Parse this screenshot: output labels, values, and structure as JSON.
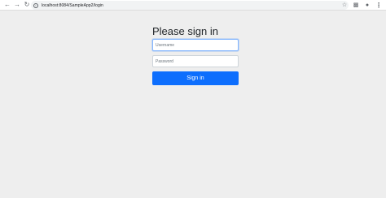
{
  "browser": {
    "back_icon": "arrow-left-icon",
    "forward_icon": "arrow-right-icon",
    "reload_icon": "reload-icon",
    "url": "localhost:8084/SampleApp2/login",
    "star_icon": "star-icon",
    "extensions_icon": "puzzle-icon",
    "profile_icon": "profile-icon",
    "menu_icon": "kebab-menu-icon"
  },
  "login": {
    "heading": "Please sign in",
    "username_placeholder": "Username",
    "password_placeholder": "Password",
    "submit_label": "Sign in"
  },
  "colors": {
    "page_background": "#eeeeee",
    "primary": "#0d6efd"
  }
}
